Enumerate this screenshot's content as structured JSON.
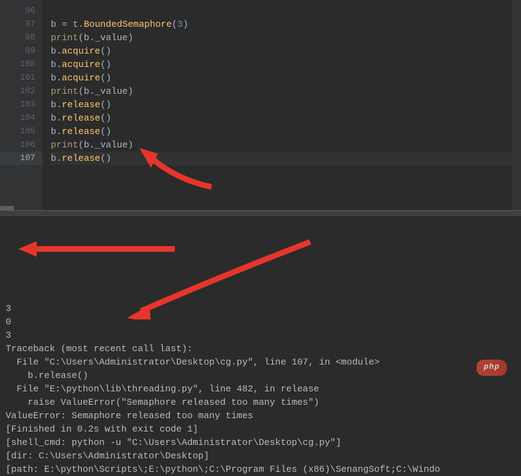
{
  "editor": {
    "lines": [
      {
        "num": 96,
        "tokens": []
      },
      {
        "num": 97,
        "tokens": [
          {
            "t": "b ",
            "c": "c-var"
          },
          {
            "t": "= ",
            "c": "c-op"
          },
          {
            "t": "t",
            "c": "c-var"
          },
          {
            "t": ".",
            "c": "c-dot"
          },
          {
            "t": "BoundedSemaphore",
            "c": "c-method"
          },
          {
            "t": "(",
            "c": "c-paren"
          },
          {
            "t": "3",
            "c": "c-num"
          },
          {
            "t": ")",
            "c": "c-paren"
          }
        ]
      },
      {
        "num": 98,
        "tokens": [
          {
            "t": "print",
            "c": "c-call"
          },
          {
            "t": "(b._value)",
            "c": "c-paren"
          }
        ]
      },
      {
        "num": 99,
        "tokens": [
          {
            "t": "b",
            "c": "c-var"
          },
          {
            "t": ".",
            "c": "c-dot"
          },
          {
            "t": "acquire",
            "c": "c-method"
          },
          {
            "t": "()",
            "c": "c-paren"
          }
        ]
      },
      {
        "num": 100,
        "tokens": [
          {
            "t": "b",
            "c": "c-var"
          },
          {
            "t": ".",
            "c": "c-dot"
          },
          {
            "t": "acquire",
            "c": "c-method"
          },
          {
            "t": "()",
            "c": "c-paren"
          }
        ]
      },
      {
        "num": 101,
        "tokens": [
          {
            "t": "b",
            "c": "c-var"
          },
          {
            "t": ".",
            "c": "c-dot"
          },
          {
            "t": "acquire",
            "c": "c-method"
          },
          {
            "t": "()",
            "c": "c-paren"
          }
        ]
      },
      {
        "num": 102,
        "tokens": [
          {
            "t": "print",
            "c": "c-call"
          },
          {
            "t": "(b._value)",
            "c": "c-paren"
          }
        ]
      },
      {
        "num": 103,
        "tokens": [
          {
            "t": "b",
            "c": "c-var"
          },
          {
            "t": ".",
            "c": "c-dot"
          },
          {
            "t": "release",
            "c": "c-method"
          },
          {
            "t": "()",
            "c": "c-paren"
          }
        ]
      },
      {
        "num": 104,
        "tokens": [
          {
            "t": "b",
            "c": "c-var"
          },
          {
            "t": ".",
            "c": "c-dot"
          },
          {
            "t": "release",
            "c": "c-method"
          },
          {
            "t": "()",
            "c": "c-paren"
          }
        ]
      },
      {
        "num": 105,
        "tokens": [
          {
            "t": "b",
            "c": "c-var"
          },
          {
            "t": ".",
            "c": "c-dot"
          },
          {
            "t": "release",
            "c": "c-method"
          },
          {
            "t": "()",
            "c": "c-paren"
          }
        ]
      },
      {
        "num": 106,
        "tokens": [
          {
            "t": "print",
            "c": "c-call"
          },
          {
            "t": "(b._value)",
            "c": "c-paren"
          }
        ]
      },
      {
        "num": 107,
        "current": true,
        "tokens": [
          {
            "t": "b",
            "c": "c-var"
          },
          {
            "t": ".",
            "c": "c-dot"
          },
          {
            "t": "release",
            "c": "c-method"
          },
          {
            "t": "()",
            "c": "c-paren"
          }
        ]
      }
    ]
  },
  "output": {
    "lines": [
      "3",
      "0",
      "3",
      "Traceback (most recent call last):",
      "  File \"C:\\Users\\Administrator\\Desktop\\cg.py\", line 107, in <module>",
      "    b.release()",
      "  File \"E:\\python\\lib\\threading.py\", line 482, in release",
      "    raise ValueError(\"Semaphore released too many times\")",
      "ValueError: Semaphore released too many times",
      "[Finished in 0.2s with exit code 1]",
      "[shell_cmd: python -u \"C:\\Users\\Administrator\\Desktop\\cg.py\"]",
      "[dir: C:\\Users\\Administrator\\Desktop]",
      "[path: E:\\python\\Scripts\\;E:\\python\\;C:\\Program Files (x86)\\SenangSoft;C:\\Windo"
    ]
  },
  "badge": {
    "text": "php"
  },
  "colors": {
    "arrow": "#e7352c"
  }
}
